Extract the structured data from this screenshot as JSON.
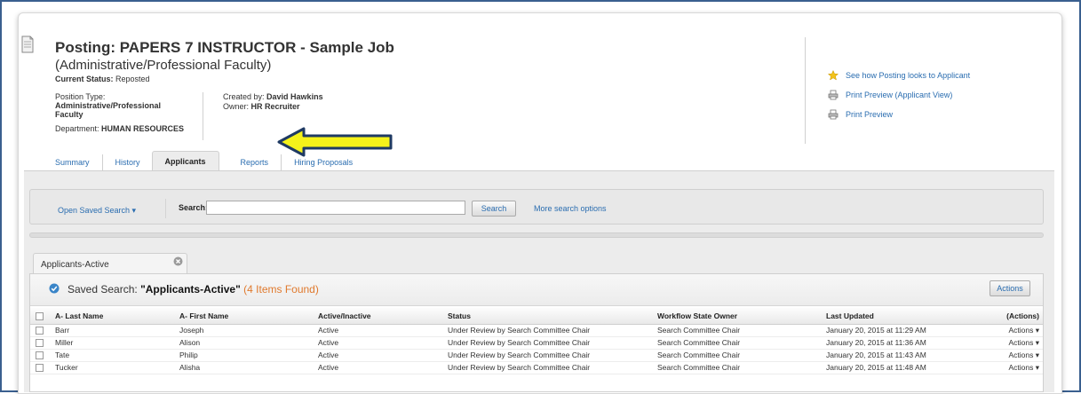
{
  "posting": {
    "title": "Posting: PAPERS 7 INSTRUCTOR - Sample Job",
    "subtitle": "(Administrative/Professional Faculty)",
    "status_label": "Current Status:",
    "status_value": "Reposted",
    "position_type_label": "Position Type:",
    "position_type_value": "Administrative/Professional Faculty",
    "department_label": "Department:",
    "department_value": "HUMAN RESOURCES",
    "created_by_label": "Created by:",
    "created_by_value": "David Hawkins",
    "owner_label": "Owner:",
    "owner_value": "HR Recruiter"
  },
  "side_links": [
    {
      "label": "See how Posting looks to Applicant",
      "icon": "star-icon"
    },
    {
      "label": "Print Preview (Applicant View)",
      "icon": "printer-icon"
    },
    {
      "label": "Print Preview",
      "icon": "printer-icon"
    }
  ],
  "tabs": [
    {
      "label": "Summary"
    },
    {
      "label": "History"
    },
    {
      "label": "Applicants",
      "active": true
    },
    {
      "label": "Reports"
    },
    {
      "label": "Hiring Proposals"
    }
  ],
  "search": {
    "saved_search_label": "Open Saved Search ▾",
    "label": "Search:",
    "value": "",
    "button": "Search",
    "more_options": "More search options"
  },
  "results": {
    "tab_label": "Applicants-Active",
    "saved_prefix": "Saved Search:",
    "saved_name": "\"Applicants-Active\"",
    "found": "(4 Items Found)",
    "actions_button": "Actions",
    "columns": [
      "A- Last Name",
      "A- First Name",
      "Active/Inactive",
      "Status",
      "Workflow State Owner",
      "Last Updated",
      "(Actions)"
    ],
    "rows": [
      {
        "last": "Barr",
        "first": "Joseph",
        "active": "Active",
        "status": "Under Review by Search Committee Chair",
        "owner": "Search Committee Chair",
        "updated": "January 20, 2015 at 11:29 AM",
        "actions": "Actions ▾"
      },
      {
        "last": "Miller",
        "first": "Alison",
        "active": "Active",
        "status": "Under Review by Search Committee Chair",
        "owner": "Search Committee Chair",
        "updated": "January 20, 2015 at 11:36 AM",
        "actions": "Actions ▾"
      },
      {
        "last": "Tate",
        "first": "Philip",
        "active": "Active",
        "status": "Under Review by Search Committee Chair",
        "owner": "Search Committee Chair",
        "updated": "January 20, 2015 at 11:43 AM",
        "actions": "Actions ▾"
      },
      {
        "last": "Tucker",
        "first": "Alisha",
        "active": "Active",
        "status": "Under Review by Search Committee Chair",
        "owner": "Search Committee Chair",
        "updated": "January 20, 2015 at 11:48 AM",
        "actions": "Actions ▾"
      }
    ]
  },
  "colors": {
    "link": "#2a6db0",
    "found": "#e07a2e",
    "arrow_fill": "#f5f21a",
    "arrow_stroke": "#1f3a63",
    "frame": "#3a5f8f"
  }
}
